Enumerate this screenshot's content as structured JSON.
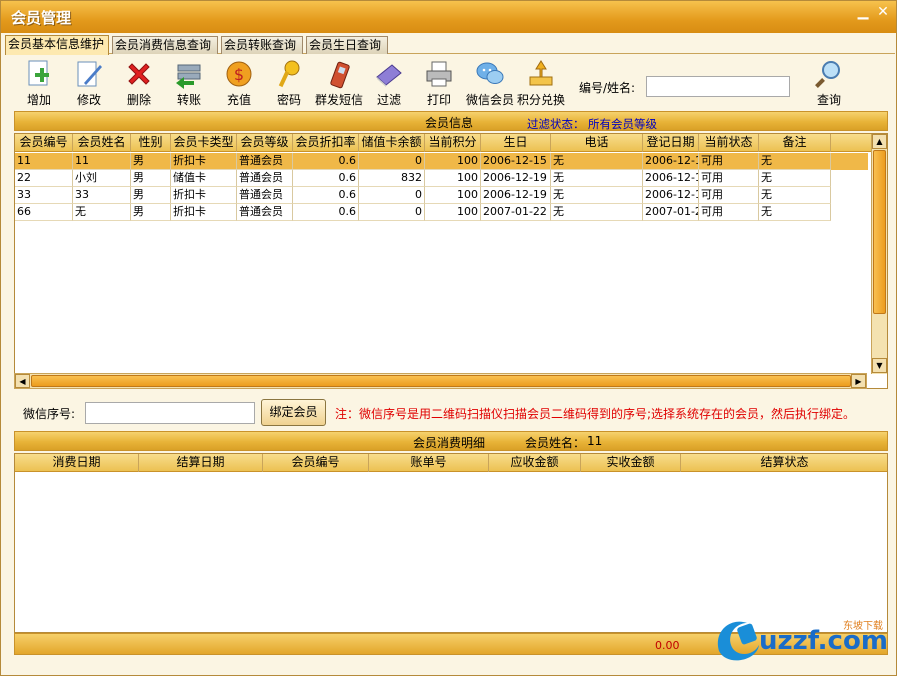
{
  "window": {
    "title": "会员管理",
    "min_icon": "minimize-icon",
    "close_icon": "close-icon"
  },
  "tabs": [
    {
      "label": "会员基本信息维护",
      "active": true
    },
    {
      "label": "会员消费信息查询",
      "active": false
    },
    {
      "label": "会员转账查询",
      "active": false
    },
    {
      "label": "会员生日查询",
      "active": false
    }
  ],
  "toolbar": {
    "buttons": [
      {
        "label": "增加",
        "icon": "add-icon"
      },
      {
        "label": "修改",
        "icon": "edit-icon"
      },
      {
        "label": "删除",
        "icon": "delete-icon"
      },
      {
        "label": "转账",
        "icon": "transfer-icon"
      },
      {
        "label": "充值",
        "icon": "recharge-icon"
      },
      {
        "label": "密码",
        "icon": "key-icon"
      },
      {
        "label": "群发短信",
        "icon": "phone-icon"
      },
      {
        "label": "过滤",
        "icon": "filter-icon"
      },
      {
        "label": "打印",
        "icon": "printer-icon"
      },
      {
        "label": "微信会员",
        "icon": "wechat-icon"
      },
      {
        "label": "积分兑换",
        "icon": "points-exchange-icon"
      }
    ],
    "search_label": "编号/姓名:",
    "search_value": "",
    "query_label": "查询"
  },
  "member_section": {
    "title": "会员信息",
    "filter_label": "过滤状态：",
    "filter_value": "所有会员等级"
  },
  "member_table": {
    "columns": [
      "会员编号",
      "会员姓名",
      "性别",
      "会员卡类型",
      "会员等级",
      "会员折扣率",
      "储值卡余额",
      "当前积分",
      "生日",
      "电话",
      "登记日期",
      "当前状态",
      "备注"
    ],
    "rows": [
      [
        "11",
        "11",
        "男",
        "折扣卡",
        "普通会员",
        "0.6",
        "0",
        "100",
        "2006-12-15",
        "无",
        "2006-12-1",
        "可用",
        "无"
      ],
      [
        "22",
        "小刘",
        "男",
        "储值卡",
        "普通会员",
        "0.6",
        "832",
        "100",
        "2006-12-19",
        "无",
        "2006-12-1",
        "可用",
        "无"
      ],
      [
        "33",
        "33",
        "男",
        "折扣卡",
        "普通会员",
        "0.6",
        "0",
        "100",
        "2006-12-19",
        "无",
        "2006-12-1",
        "可用",
        "无"
      ],
      [
        "66",
        "无",
        "男",
        "折扣卡",
        "普通会员",
        "0.6",
        "0",
        "100",
        "2007-01-22",
        "无",
        "2007-01-2",
        "可用",
        "无"
      ]
    ],
    "selected_row": 0
  },
  "wechat": {
    "label": "微信序号:",
    "value": "",
    "bind_label": "绑定会员",
    "note": "注：微信序号是用二维码扫描仪扫描会员二维码得到的序号;选择系统存在的会员，然后执行绑定。"
  },
  "detail_section": {
    "title": "会员消费明细",
    "name_label": "会员姓名：",
    "name_value": "11"
  },
  "detail_table": {
    "columns": [
      "消费日期",
      "结算日期",
      "会员编号",
      "账单号",
      "应收金额",
      "实收金额",
      "结算状态"
    ],
    "rows": []
  },
  "footer": {
    "total": "0.00"
  },
  "watermark": {
    "text": "uzzf.com",
    "sub": "东坡下载"
  },
  "colors": {
    "accent": "#e8b338",
    "selected_row": "#f0b848",
    "note": "#e00000",
    "filter": "#0000c0"
  }
}
